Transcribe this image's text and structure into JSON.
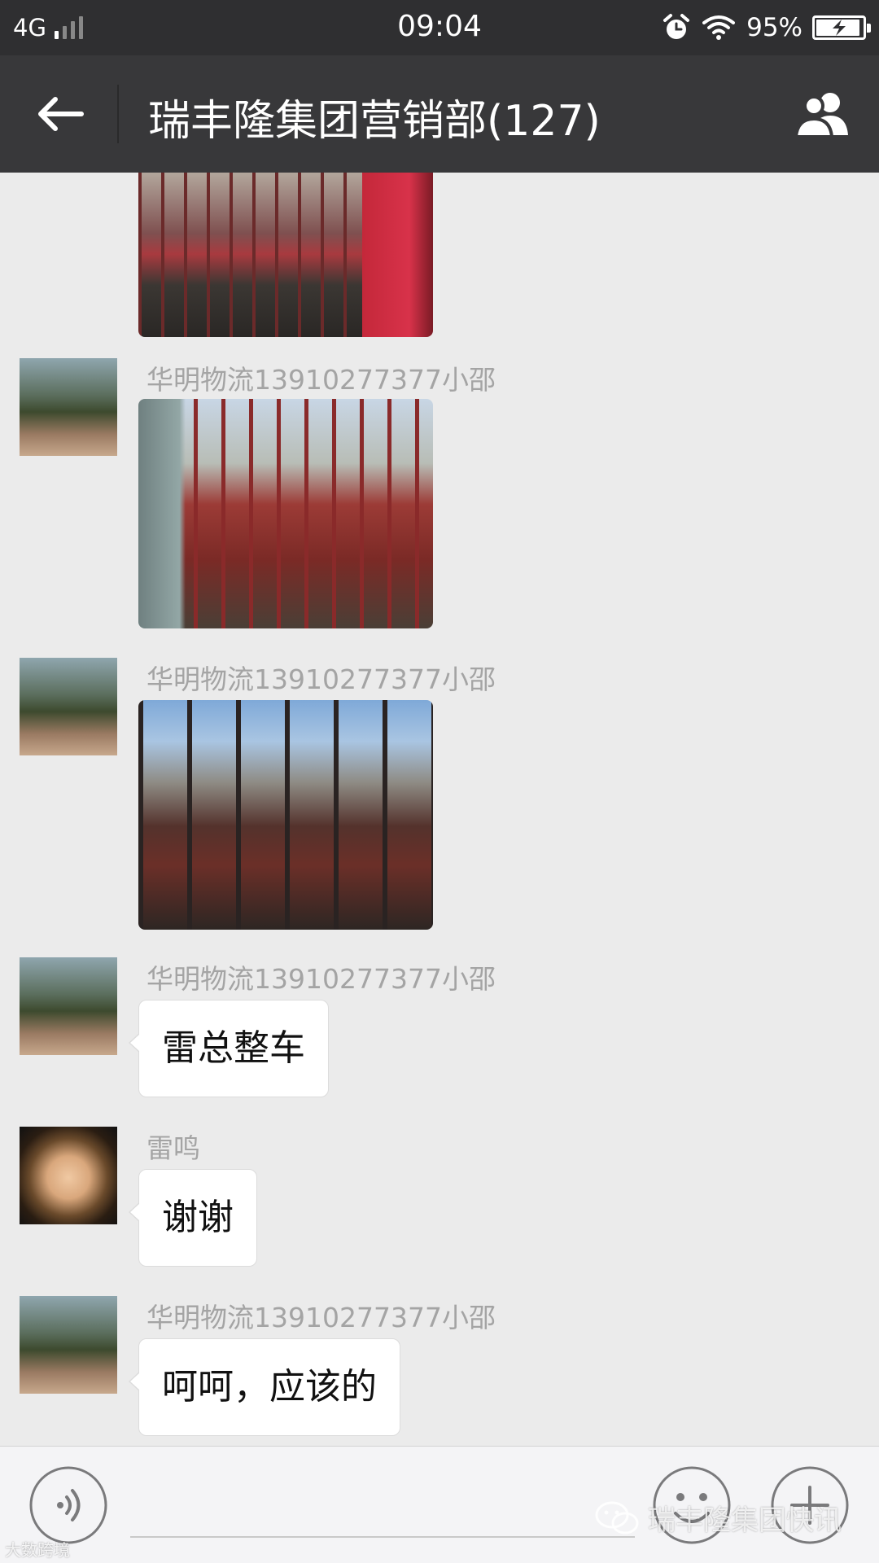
{
  "status_bar": {
    "network": "4G",
    "time": "09:04",
    "battery": "95%",
    "battery_level": 0.95,
    "icons": [
      "signal-icon",
      "alarm-icon",
      "wifi-icon",
      "battery-charging-icon"
    ]
  },
  "header": {
    "title": "瑞丰隆集团营销部(127)",
    "icons": [
      "back-arrow-icon",
      "group-members-icon"
    ]
  },
  "messages": [
    {
      "type": "image",
      "sender": "",
      "avatar": "landscape",
      "image": "red-truck-partial"
    },
    {
      "type": "image",
      "sender": "华明物流13910277377小邵",
      "avatar": "landscape",
      "image": "red-truck-loaded"
    },
    {
      "type": "image",
      "sender": "华明物流13910277377小邵",
      "avatar": "landscape",
      "image": "red-truck-cargo"
    },
    {
      "type": "text",
      "sender": "华明物流13910277377小邵",
      "avatar": "landscape",
      "text": "雷总整车"
    },
    {
      "type": "text",
      "sender": "雷鸣",
      "avatar": "child",
      "text": "谢谢"
    },
    {
      "type": "text",
      "sender": "华明物流13910277377小邵",
      "avatar": "landscape",
      "text": "呵呵，应该的"
    }
  ],
  "input_bar": {
    "icons": [
      "voice-icon",
      "emoji-icon",
      "plus-icon"
    ]
  },
  "watermark": {
    "text": "瑞丰隆集团快讯",
    "corner": "大数跨境"
  }
}
